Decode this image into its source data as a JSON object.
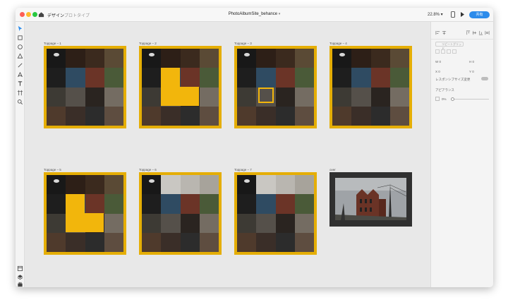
{
  "window": {
    "document_title": "PhotoAlbumSite_behance",
    "tabs": [
      {
        "label": "デザイン",
        "active": true
      },
      {
        "label": "プロトタイプ",
        "active": false
      }
    ],
    "zoom": "22.8%",
    "share_label": "共有",
    "traffic_lights": [
      "#fd5f57",
      "#febc2e",
      "#28c840"
    ]
  },
  "toolbar": {
    "top_icons": [
      "select-icon",
      "rectangle-icon",
      "ellipse-icon",
      "triangle-icon",
      "line-icon",
      "pen-icon",
      "text-icon",
      "artboard-icon",
      "zoom-icon"
    ],
    "bottom_icons": [
      "assets-icon",
      "layers-icon",
      "plugins-icon"
    ]
  },
  "canvas": {
    "accent": "#e5ae05",
    "artboards": [
      {
        "label": "Toppage – 1",
        "variant": "base"
      },
      {
        "label": "Toppage – 2",
        "variant": "blocks"
      },
      {
        "label": "Toppage – 3",
        "variant": "outline"
      },
      {
        "label": "Toppage – 4",
        "variant": "base"
      },
      {
        "label": "Toppage – 5",
        "variant": "blocks"
      },
      {
        "label": "Toppage – 6",
        "variant": "gauges"
      },
      {
        "label": "Toppage – 7",
        "variant": "gauges"
      }
    ],
    "over_artboard": {
      "label": "over"
    }
  },
  "panel": {
    "repeat_grid_label": "リピートグリッド",
    "w_label": "W",
    "w_value": "0",
    "h_label": "H",
    "h_value": "0",
    "x_label": "X",
    "x_value": "0",
    "y_label": "Y",
    "y_value": "0",
    "responsive_label": "レスポンシブサイズ変更",
    "appearance_label": "アピアランス",
    "opacity_value": "0%"
  }
}
